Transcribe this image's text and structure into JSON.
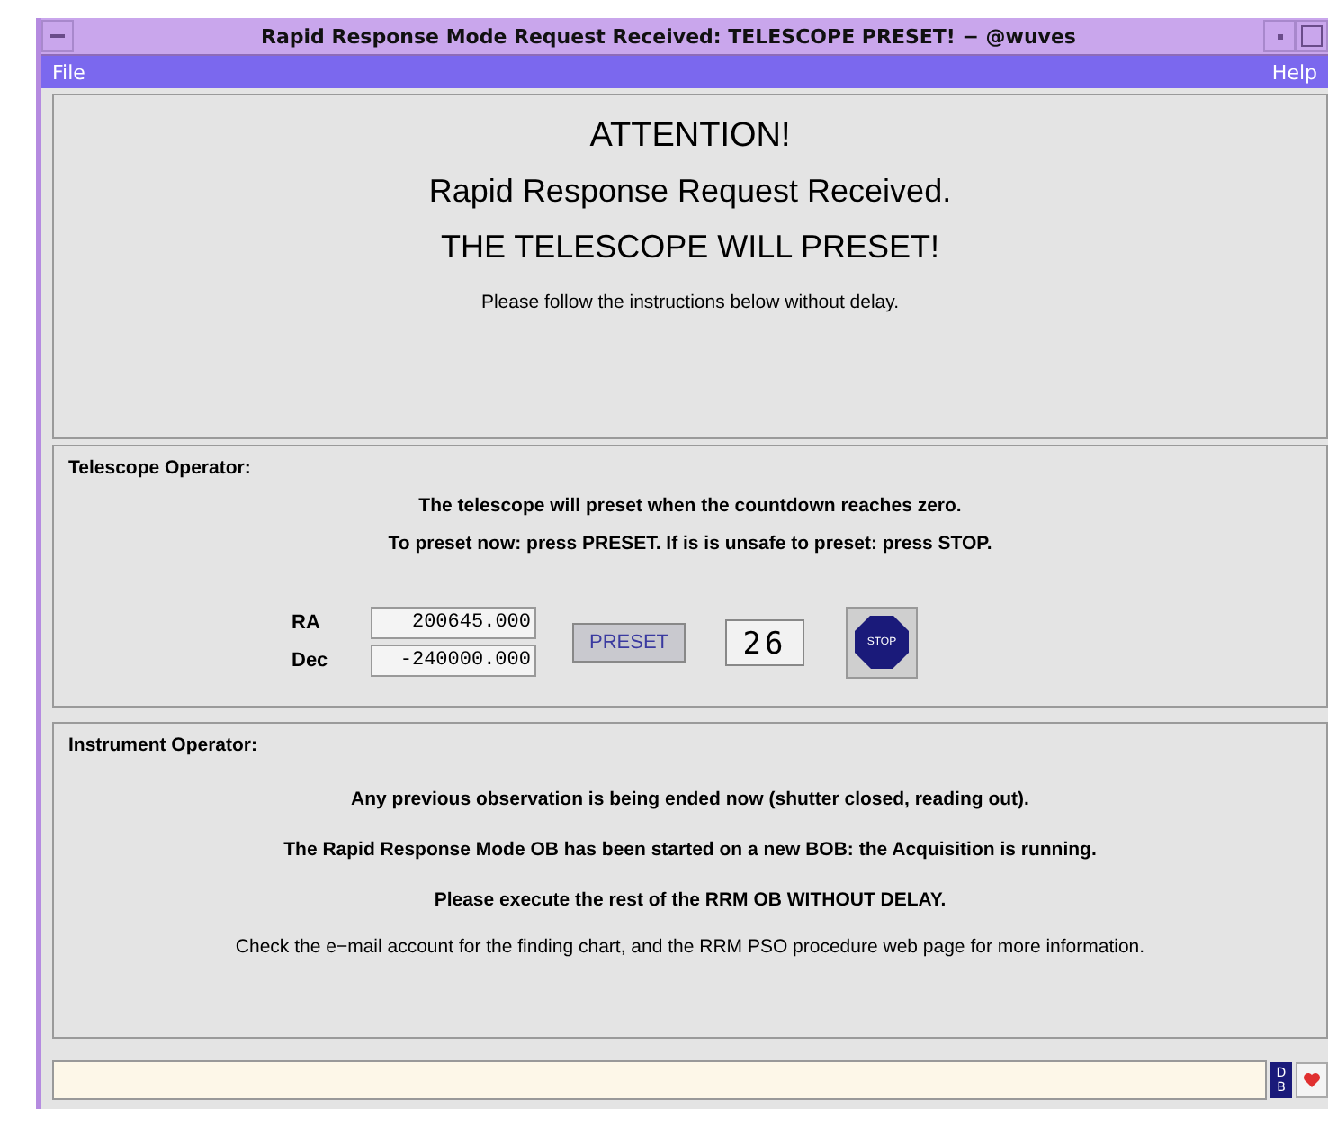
{
  "window": {
    "title": "Rapid Response Mode Request Received: TELESCOPE PRESET! − @wuves"
  },
  "menu": [
    "File",
    "Help"
  ],
  "attention": {
    "heading": "ATTENTION!",
    "line_1": "Rapid Response Request Received.",
    "line_2": "THE TELESCOPE WILL PRESET!",
    "note": "Please follow the instructions below without delay."
  },
  "telescope_operator": {
    "title": "Telescope Operator:",
    "lines": [
      "The telescope will preset when the countdown reaches zero.",
      "To preset now: press PRESET.  If is is unsafe to preset: press STOP."
    ],
    "fields": [
      {
        "label": "RA",
        "value": "200645.000"
      },
      {
        "label": "Dec",
        "value": "-240000.000"
      }
    ],
    "preset_button": "PRESET",
    "countdown": "26",
    "stop_button": "STOP"
  },
  "instrument_operator": {
    "title": "Instrument Operator:",
    "lines": [
      "Any previous observation is being ended now (shutter closed, reading out).",
      "The Rapid Response Mode OB has been started on a new BOB: the Acquisition is running.",
      "Please execute the rest of the RRM OB WITHOUT DELAY."
    ],
    "note": "Check the e−mail account for the finding chart, and the RRM PSO procedure web page for more information."
  },
  "status_bar": {
    "db_badge": [
      "D",
      "B"
    ]
  }
}
